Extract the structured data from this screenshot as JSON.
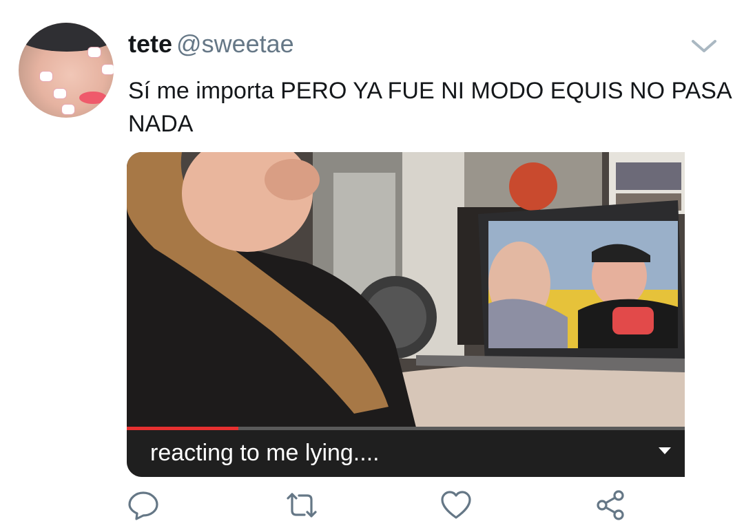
{
  "tweet": {
    "author_name": "tete",
    "author_handle": "@sweetae",
    "text": "Sí me importa PERO YA FUE NI MODO EQUIS NO PASA NADA",
    "media_caption": "reacting to me lying....",
    "video_progress_fraction": 0.2
  },
  "icons": {
    "reply": "reply-icon",
    "retweet": "retweet-icon",
    "like": "heart-icon",
    "share": "share-icon",
    "menu": "chevron-down-icon"
  },
  "colors": {
    "text_primary": "#14171a",
    "text_secondary": "#657786",
    "icon_gray": "#657786",
    "progress_red": "#e63030"
  }
}
